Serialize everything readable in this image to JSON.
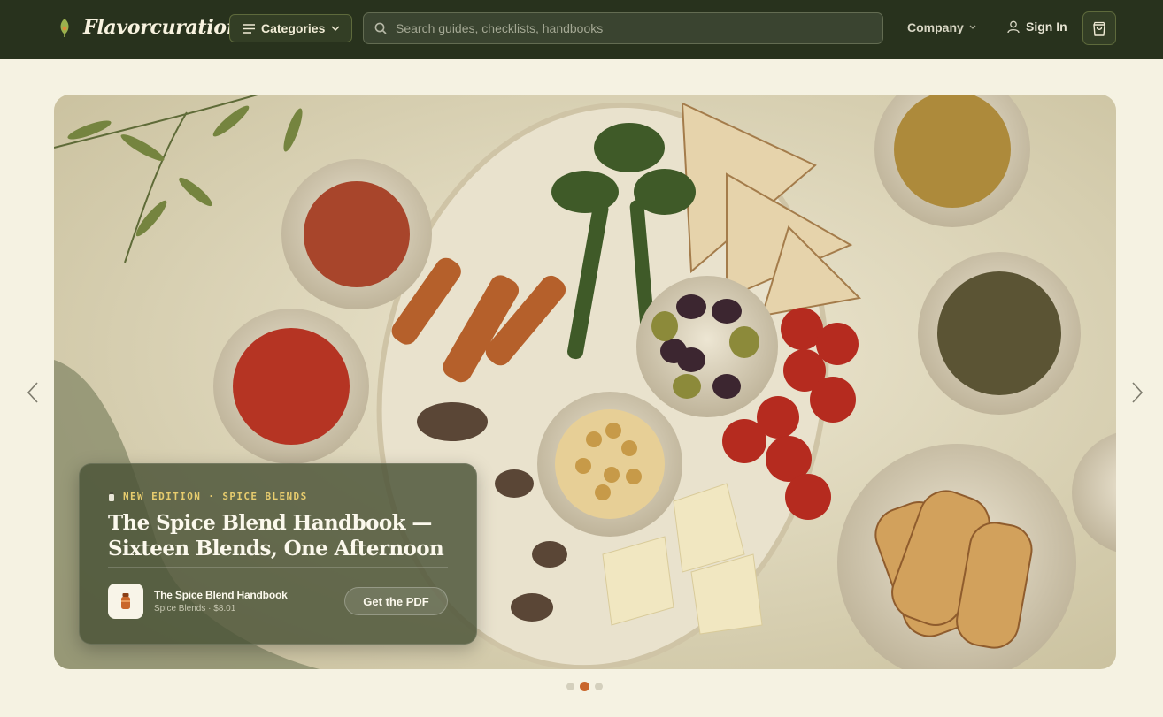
{
  "header": {
    "brand": "Flavorcuration",
    "categories_label": "Categories",
    "search_placeholder": "Search guides, checklists, handbooks",
    "company_label": "Company",
    "signin_label": "Sign In"
  },
  "hero": {
    "eyebrow": "NEW EDITION · SPICE BLENDS",
    "title": "The Spice Blend Handbook — Sixteen Blends, One Afternoon",
    "product_name": "The Spice Blend Handbook",
    "product_meta": "Spice Blends · $8.01",
    "cta_label": "Get the PDF"
  },
  "carousel": {
    "slide_count": 3,
    "active_index": 1
  },
  "colors": {
    "header_bg": "#28321d",
    "page_bg": "#f5f2e2",
    "accent": "#c9662b",
    "eyebrow": "#e7cc6e"
  }
}
